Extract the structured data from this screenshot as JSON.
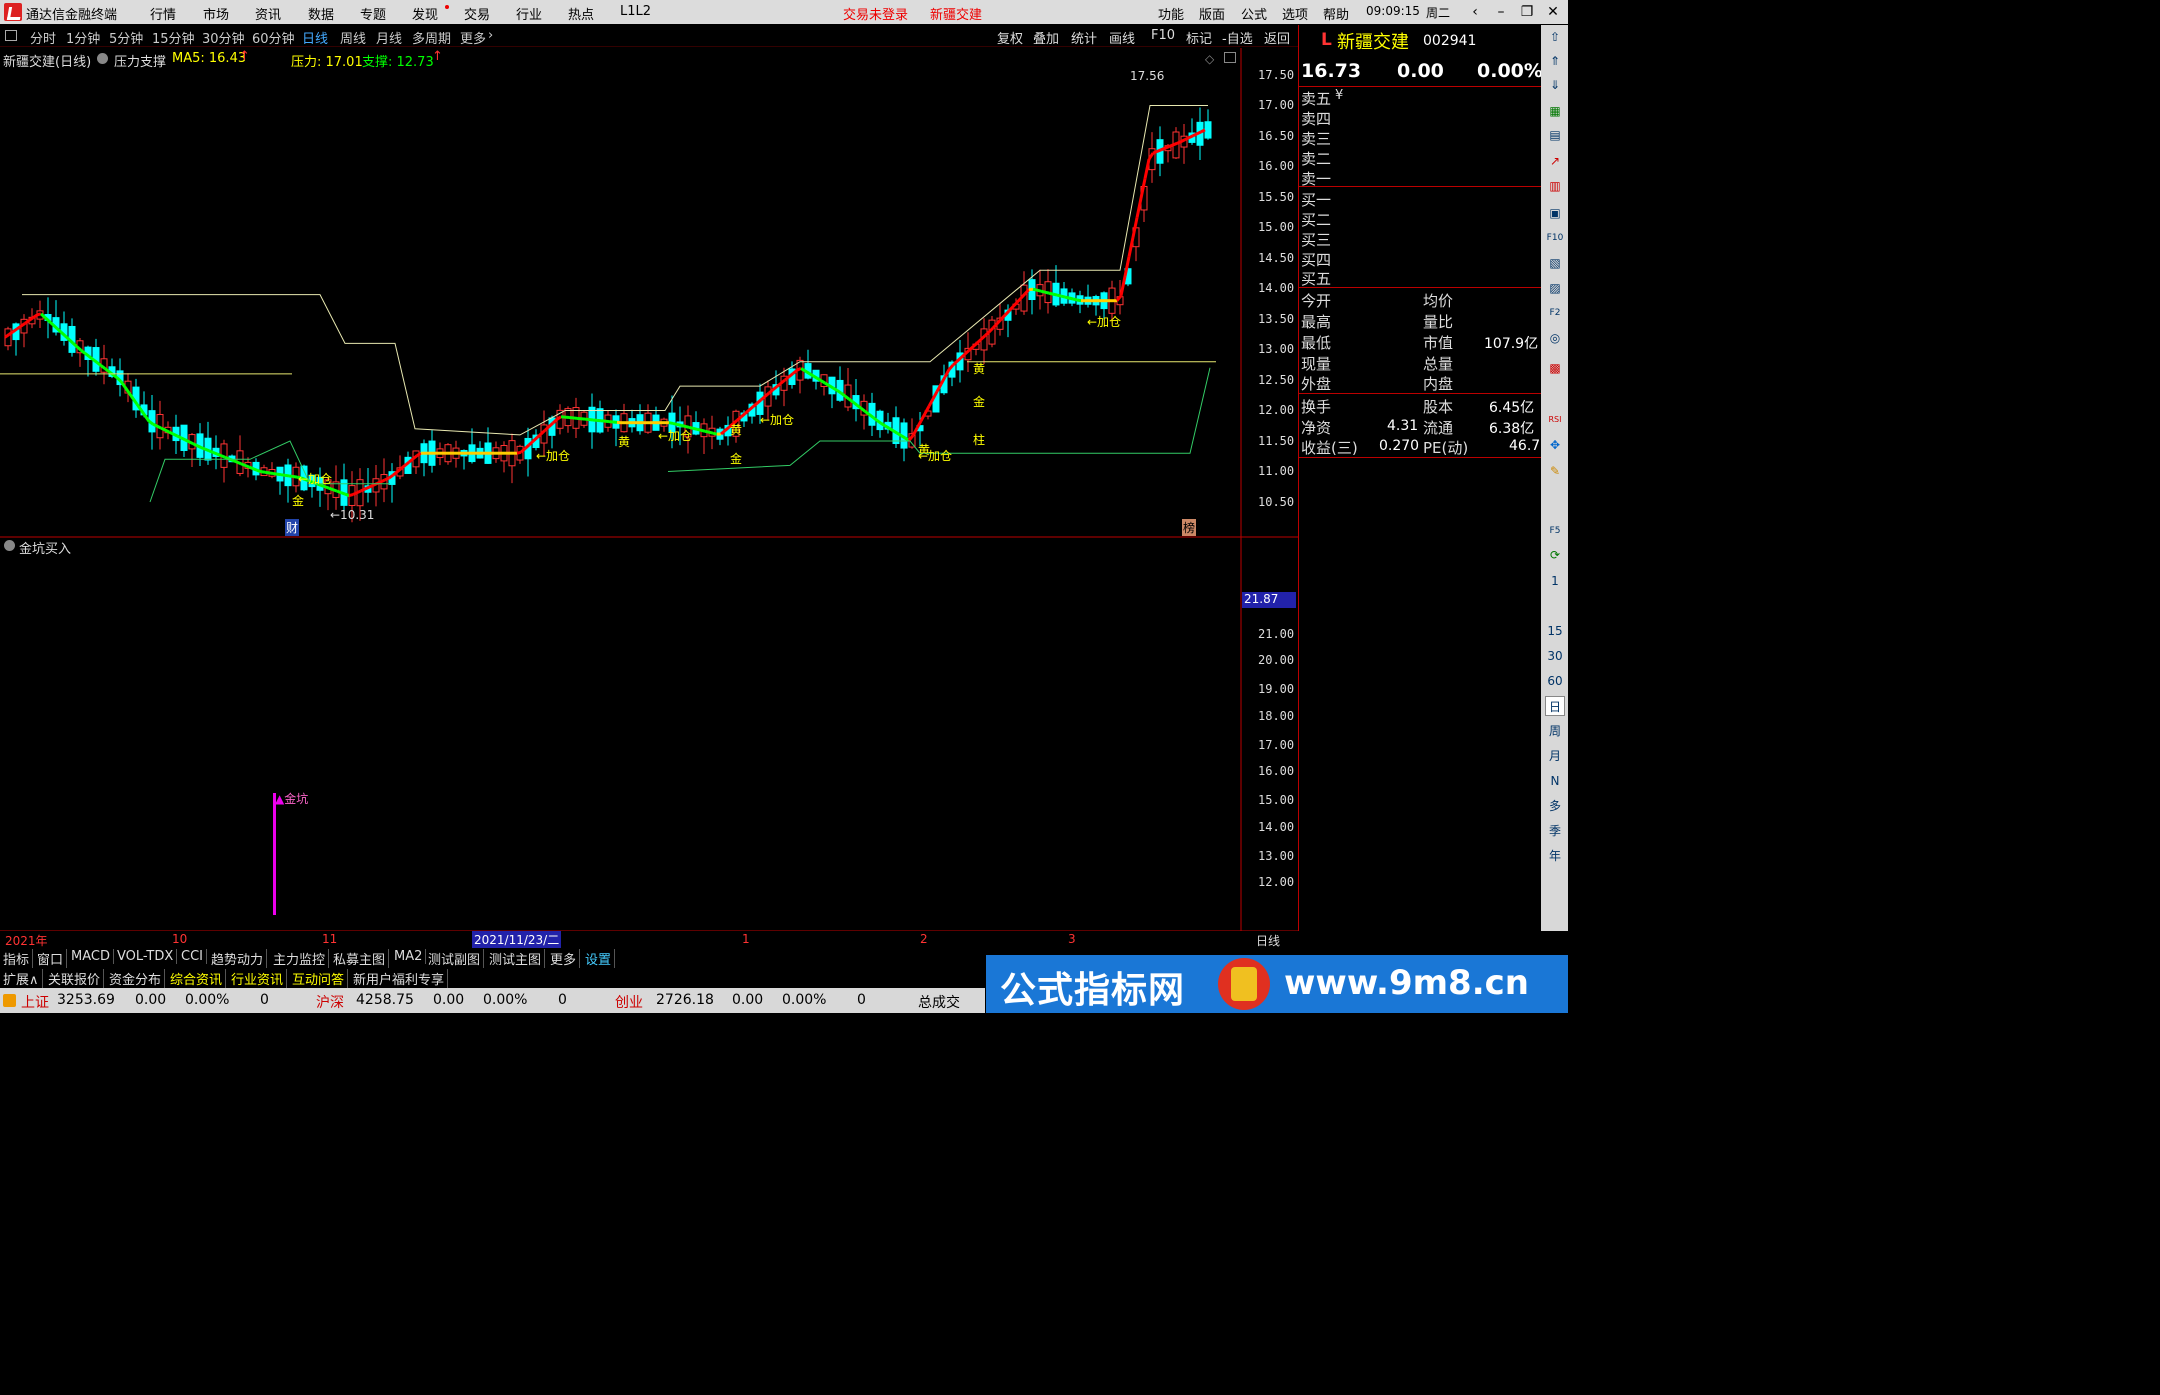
{
  "menubar": {
    "app_title": "通达信金融终端",
    "items": [
      "行情",
      "市场",
      "资讯",
      "数据",
      "专题",
      "发现",
      "交易",
      "行业",
      "热点",
      "L1L2"
    ],
    "login_status": "交易未登录",
    "stock_name": "新疆交建",
    "right_items": [
      "功能",
      "版面",
      "公式",
      "选项",
      "帮助"
    ],
    "time": "09:09:15",
    "weekday": "周二"
  },
  "periods": {
    "items": [
      "分时",
      "1分钟",
      "5分钟",
      "15分钟",
      "30分钟",
      "60分钟",
      "日线",
      "周线",
      "月线",
      "多周期",
      "更多"
    ],
    "selected": "日线",
    "right_items": [
      "复权",
      "叠加",
      "统计",
      "画线",
      "F10",
      "标记",
      "-自选",
      "返回"
    ]
  },
  "main_chart": {
    "title": "新疆交建(日线)",
    "indicator": "压力支撑",
    "ma5": "MA5: 16.43",
    "pressure": "压力: 17.01",
    "support": "支撑: 12.73",
    "peak_label": "17.56",
    "low_label": "←10.31",
    "y_ticks": [
      "17.50",
      "17.00",
      "16.50",
      "16.00",
      "15.50",
      "15.00",
      "14.50",
      "14.00",
      "13.50",
      "13.00",
      "12.50",
      "12.00",
      "11.50",
      "11.00",
      "10.50"
    ],
    "annotations": [
      "←加仓",
      "←加仓",
      "←加仓",
      "←加仓",
      "←加仓",
      "←加仓",
      "金",
      "黄",
      "黄",
      "金",
      "黄",
      "金",
      "柱",
      "黄",
      "金"
    ],
    "event_marks": [
      "财",
      "榜"
    ]
  },
  "sub_chart": {
    "title": "金坑买入",
    "current_value": "21.87",
    "y_ticks": [
      "21.00",
      "20.00",
      "19.00",
      "18.00",
      "17.00",
      "16.00",
      "15.00",
      "14.00",
      "13.00",
      "12.00"
    ],
    "signal_label": "金坑"
  },
  "time_axis": {
    "labels": [
      "2021年",
      "10",
      "11",
      "2021/11/23/二",
      "1",
      "2",
      "3"
    ],
    "period": "日线"
  },
  "quote_panel": {
    "code_prefix": "L",
    "name": "新疆交建",
    "code": "002941",
    "price": "16.73",
    "change": "0.00",
    "change_pct": "0.00%",
    "sell_levels": [
      "卖五",
      "卖四",
      "卖三",
      "卖二",
      "卖一"
    ],
    "buy_levels": [
      "买一",
      "买二",
      "买三",
      "买四",
      "买五"
    ],
    "sell_currency": "¥",
    "stats_left": [
      "今开",
      "最高",
      "最低",
      "现量",
      "外盘"
    ],
    "stats_right": [
      "均价",
      "量比",
      "市值",
      "总量",
      "内盘"
    ],
    "market_cap": "107.9亿",
    "fundamentals": [
      {
        "l": "换手",
        "lv": "",
        "r": "股本",
        "rv": "6.45亿"
      },
      {
        "l": "净资",
        "lv": "4.31",
        "r": "流通",
        "rv": "6.38亿"
      },
      {
        "l": "收益(三)",
        "lv": "0.270",
        "r": "PE(动)",
        "rv": "46.7"
      }
    ]
  },
  "sidebar": {
    "period_shortcuts": [
      "1",
      "15",
      "30",
      "60",
      "日",
      "周",
      "月",
      "N",
      "多",
      "季",
      "年"
    ]
  },
  "indicator_tabs": [
    "指标",
    "窗口",
    "MACD",
    "VOL-TDX",
    "CCI",
    "趋势动力",
    "主力监控",
    "私募主图",
    "MA2",
    "测试副图",
    "测试主图",
    "更多",
    "设置"
  ],
  "info_tabs": [
    "扩展∧",
    "关联报价",
    "资金分布",
    "综合资讯",
    "行业资讯",
    "互动问答",
    "新用户福利专享"
  ],
  "status_bar": {
    "sh_name": "上证",
    "sh_value": "3253.69",
    "sh_change": "0.00",
    "sh_pct": "0.00%",
    "sh_vol": "0",
    "hs_name": "沪深",
    "hs_value": "4258.75",
    "hs_change": "0.00",
    "hs_pct": "0.00%",
    "hs_vol": "0",
    "cy_name": "创业",
    "cy_value": "2726.18",
    "cy_change": "0.00",
    "cy_pct": "0.00%",
    "cy_vol": "0",
    "deal": "总成交"
  },
  "banner": {
    "text": "公式指标网",
    "url": "www.9m8.cn"
  },
  "colors": {
    "up": "#ff3333",
    "down": "#00ffff",
    "ma": "#ff0000",
    "yellow": "#ffff00",
    "green": "#00ff00"
  }
}
